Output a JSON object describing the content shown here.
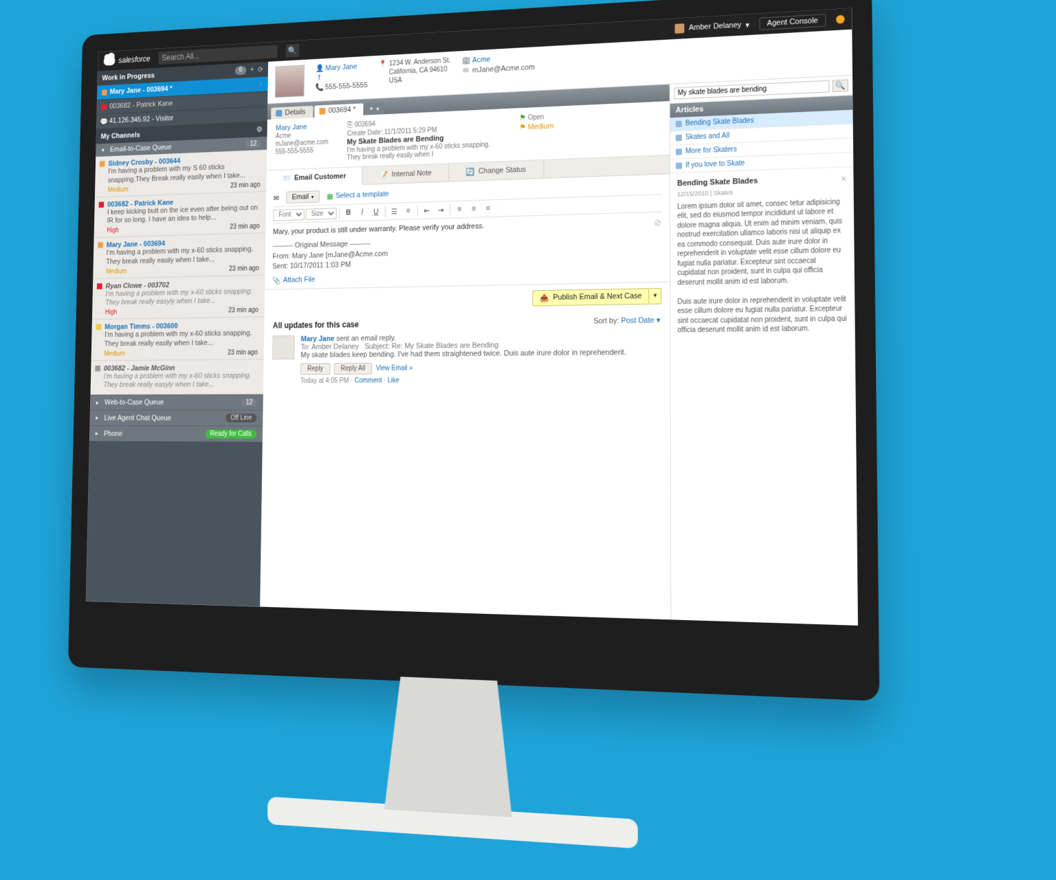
{
  "topbar": {
    "brand": "salesforce",
    "search_placeholder": "Search All...",
    "user_name": "Amber Delaney",
    "console_btn": "Agent Console"
  },
  "sidebar": {
    "wip_header": "Work in Progress",
    "wip_count": "6",
    "wip": [
      {
        "label": "Mary Jane - 003694 *"
      },
      {
        "label": "003682 - Patrick Kane"
      },
      {
        "label": "41.126.345.92 - Visitor"
      }
    ],
    "channels_header": "My Channels",
    "queue1": {
      "label": "Email-to-Case Queue",
      "count": "12"
    },
    "cases": [
      {
        "flag": "orange",
        "title": "Sidney Crosby - 003644",
        "body": "I'm having a problem with my S 60 sticks snapping.They Break really easily when I take...",
        "priority": "Medium",
        "time": "23 min ago"
      },
      {
        "flag": "red",
        "title": "003682 - Patrick Kane",
        "body": "I keep kicking butt on the ice even after being out on IR for so long. I have an idea to help...",
        "priority": "High",
        "time": "23 min ago"
      },
      {
        "flag": "orange",
        "title": "Mary Jane - 003694",
        "body": "I'm having a problem with my x-60 sticks snapping. They break really easily when I take...",
        "priority": "Medium",
        "time": "23 min ago"
      },
      {
        "flag": "red",
        "title": "Ryan Clowe - 003702",
        "muted": true,
        "body": "I'm having a problem with my x-60 sticks snapping. They break really easyly when I take...",
        "priority": "High",
        "time": "23 min ago"
      },
      {
        "flag": "yellow",
        "title": "Morgan Timms - 003600",
        "body": "I'm having a problem with my x-60 sticks snapping. They break really easily when I take...",
        "priority": "Medium",
        "time": "23 min ago"
      },
      {
        "flag": "gray",
        "title": "003682 - Jamie McGinn",
        "muted": true,
        "body": "I'm having a problem with my x-60 sticks snapping. They break really easyly when I take...",
        "priority": "",
        "time": ""
      }
    ],
    "queue2": {
      "label": "Web-to-Case Queue",
      "count": "12"
    },
    "queue3": {
      "label": "Live Agent Chat Queue",
      "pill": "Off Line"
    },
    "queue4": {
      "label": "Phone",
      "pill": "Ready for Calls"
    }
  },
  "contact": {
    "name": "Mary Jane",
    "phone": "555-555-5555",
    "addr1": "1234 W. Anderson St.",
    "addr2": "California, CA 94610",
    "addr3": "USA",
    "account": "Acme",
    "email": "mJane@Acme.com"
  },
  "tabs": {
    "t1": "Details",
    "t2": "003694 *"
  },
  "caseinfo": {
    "contact_name": "Mary Jane",
    "acct": "Acme",
    "cemail": "mJane@acme.com",
    "cphone": "555-555-5555",
    "caseno": "003694",
    "created": "Create Date: 11/1/2011 5:29 PM",
    "subject": "My Skate Blades are Bending",
    "desc": "I'm having a problem with my x-60 sticks snapping. They break really easily when I",
    "status": "Open",
    "priority": "Medium"
  },
  "atabs": {
    "email": "Email Customer",
    "note": "Internal Note",
    "status": "Change Status"
  },
  "composer": {
    "email_btn": "Email",
    "template": "Select a template",
    "font": "Font",
    "size": "Size",
    "line1": "Mary, your product is still under warranty. Please verify your address.",
    "orig_hdr": "--------- Original Message ---------",
    "orig_from": "From: Mary Jane [mJane@Acme.com",
    "orig_sent": "Sent: 10/17/2011 1:03 PM",
    "attach": "Attach File"
  },
  "publish_btn": "Publish Email & Next Case",
  "updates": {
    "header": "All updates for this case",
    "sort_label": "Sort by:",
    "sort_value": "Post Date",
    "name": "Mary Jane",
    "action": "sent an email reply.",
    "to_label": "To:",
    "to": "Amber Delaney",
    "subj_label": "Subject: Re:",
    "subj": "My Skate Blades are Bending",
    "body": "My skate blades keep bending. I've had them straightened twice. Duis aute irure dolor in reprehenderit.",
    "reply": "Reply",
    "reply_all": "Reply All",
    "view": "View Email »",
    "time": "Today at 4:05 PM",
    "comment": "Comment",
    "like": "Like"
  },
  "right": {
    "search_value": "My skate blades are bending",
    "hdr": "Articles",
    "items": [
      "Bending Skate Blades",
      "Skates and All",
      "More for Skaters",
      "If you love to Skate"
    ],
    "art_title": "Bending Skate Blades",
    "art_meta": "12/15/2010 | Skates",
    "art_p1": "Lorem ipsum dolor sit amet, consec tetur adipisicing elit, sed do eiusmod tempor incididunt ut labore et dolore magna aliqua. Ut enim ad minim veniam, quis nostrud exercitation ullamco laboris nisi ut aliquip ex ea commodo consequat. Duis aute irure dolor in reprehenderit in voluptate velit esse cillum dolore eu fugiat nulla pariatur. Excepteur sint occaecat cupidatat non proident, sunt in culpa qui officia deserunt mollit anim id est laborum.",
    "art_p2": "Duis aute irure dolor in reprehenderit in voluptate velit esse cillum dolore eu fugiat nulla pariatur. Excepteur sint occaecat cupidatat non proident, sunt in culpa qui officia deserunt mollit anim id est laborum."
  }
}
